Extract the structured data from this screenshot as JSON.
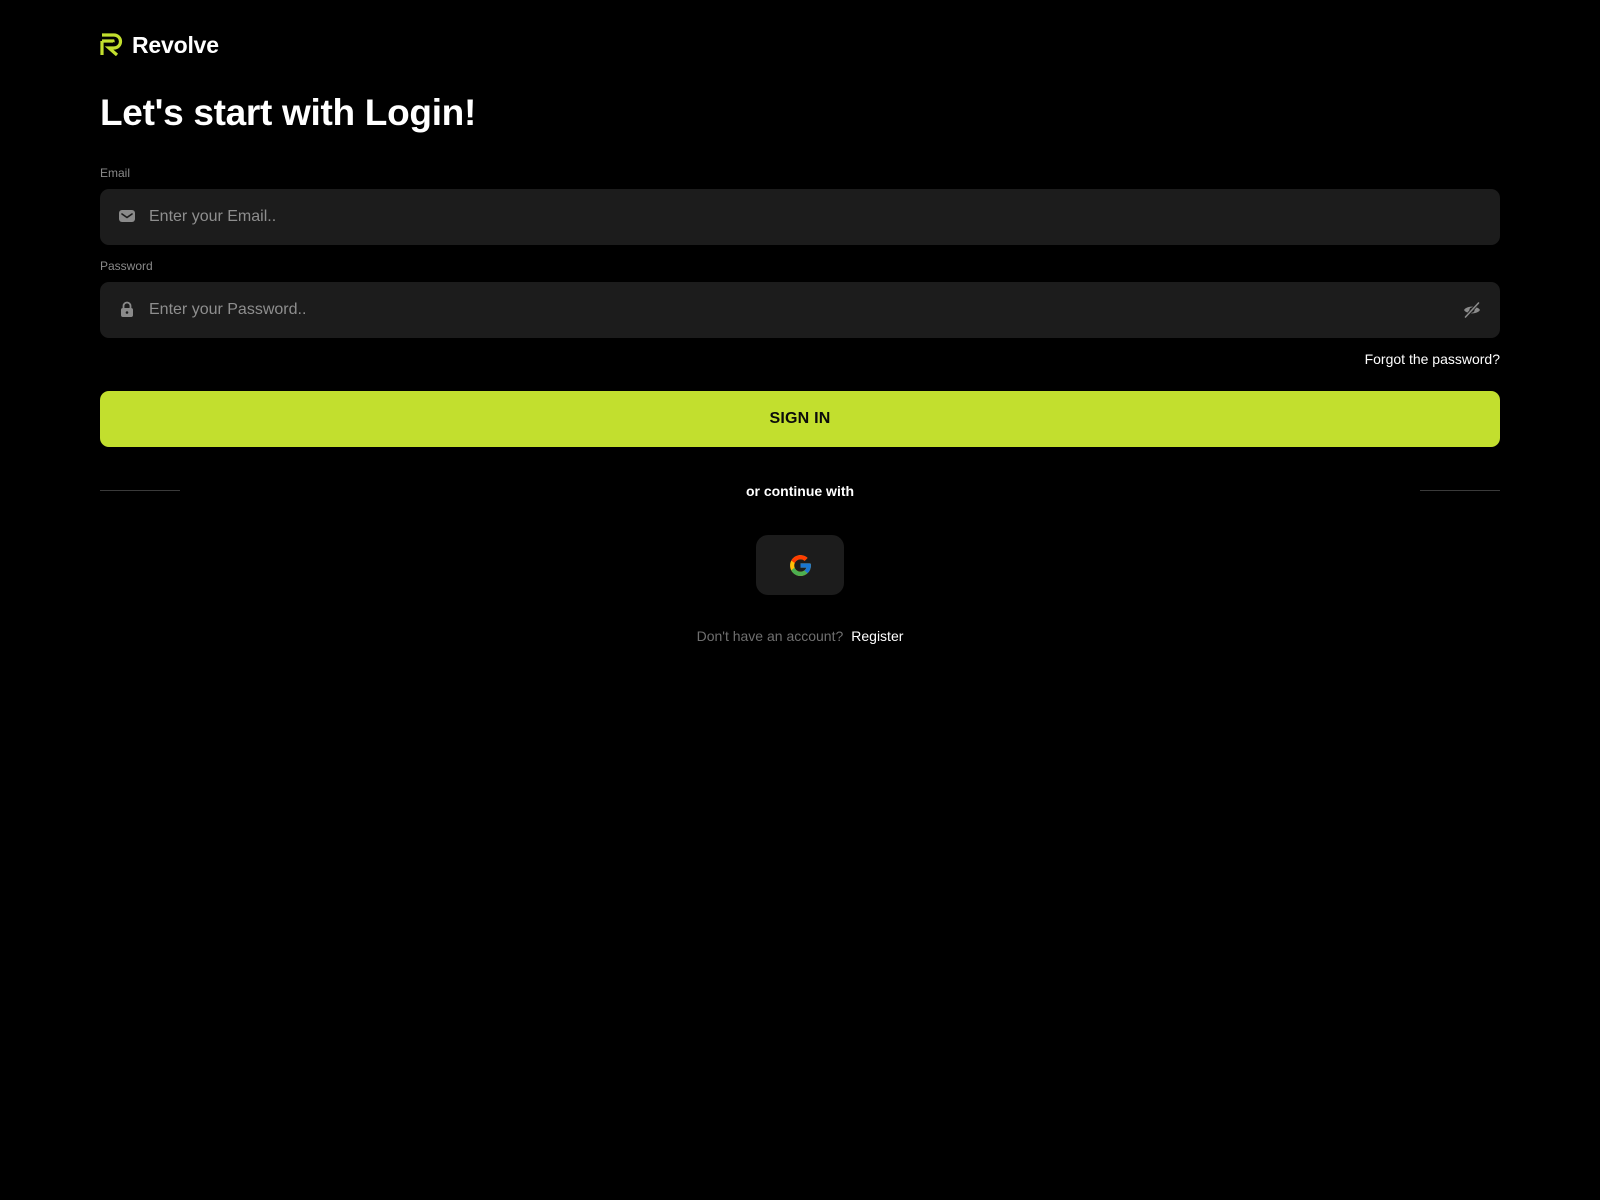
{
  "brand": {
    "name": "Revolve",
    "accent_color": "#c2df2e"
  },
  "page": {
    "title": "Let's start with Login!"
  },
  "form": {
    "email": {
      "label": "Email",
      "placeholder": "Enter your Email..",
      "value": "",
      "icon": "mail-icon"
    },
    "password": {
      "label": "Password",
      "placeholder": "Enter your Password..",
      "value": "",
      "icon": "lock-icon",
      "toggle_icon": "eye-off-icon"
    },
    "forgot_label": "Forgot the password?",
    "submit_label": "SIGN IN"
  },
  "social": {
    "divider_text": "or continue with",
    "providers": [
      {
        "name": "google",
        "icon": "google-icon"
      }
    ]
  },
  "footer": {
    "prompt": "Don't have an account?",
    "register_label": "Register"
  }
}
